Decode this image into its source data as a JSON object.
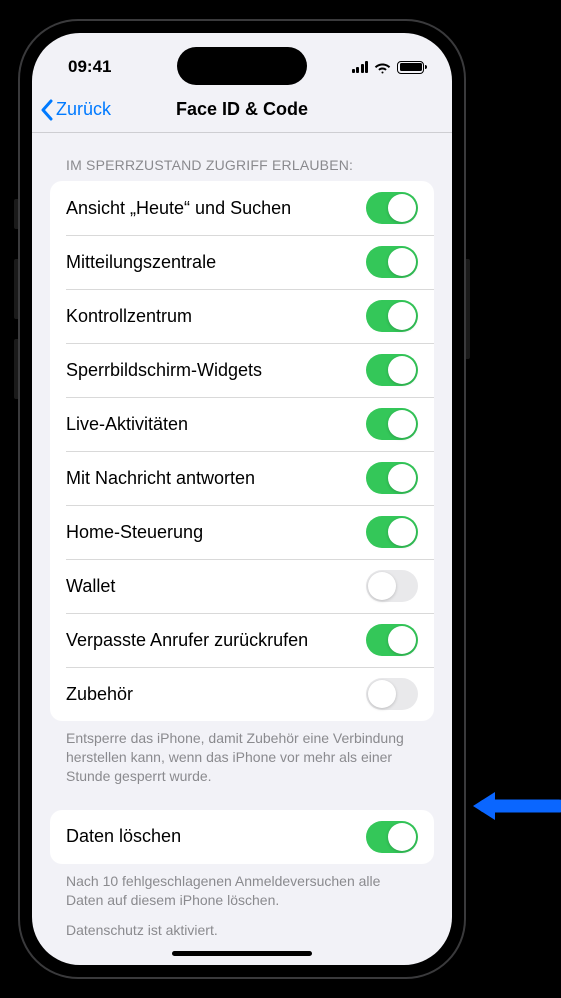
{
  "status": {
    "time": "09:41"
  },
  "nav": {
    "back_label": "Zurück",
    "title": "Face ID & Code"
  },
  "section1": {
    "header": "Im Sperrzustand Zugriff erlauben:",
    "rows": [
      {
        "label": "Ansicht „Heute“ und Suchen",
        "on": true
      },
      {
        "label": "Mitteilungszentrale",
        "on": true
      },
      {
        "label": "Kontrollzentrum",
        "on": true
      },
      {
        "label": "Sperrbildschirm-Widgets",
        "on": true
      },
      {
        "label": "Live-Aktivitäten",
        "on": true
      },
      {
        "label": "Mit Nachricht antworten",
        "on": true
      },
      {
        "label": "Home-Steuerung",
        "on": true
      },
      {
        "label": "Wallet",
        "on": false
      },
      {
        "label": "Verpasste Anrufer zurückrufen",
        "on": true
      },
      {
        "label": "Zubehör",
        "on": false
      }
    ],
    "footer": "Entsperre das iPhone, damit Zubehör eine Verbindung herstellen kann, wenn das iPhone vor mehr als einer Stunde gesperrt wurde."
  },
  "section2": {
    "rows": [
      {
        "label": "Daten löschen",
        "on": true
      }
    ],
    "footer1": "Nach 10 fehlgeschlagenen Anmeldeversuchen alle Daten auf diesem iPhone löschen.",
    "footer2": "Datenschutz ist aktiviert."
  }
}
